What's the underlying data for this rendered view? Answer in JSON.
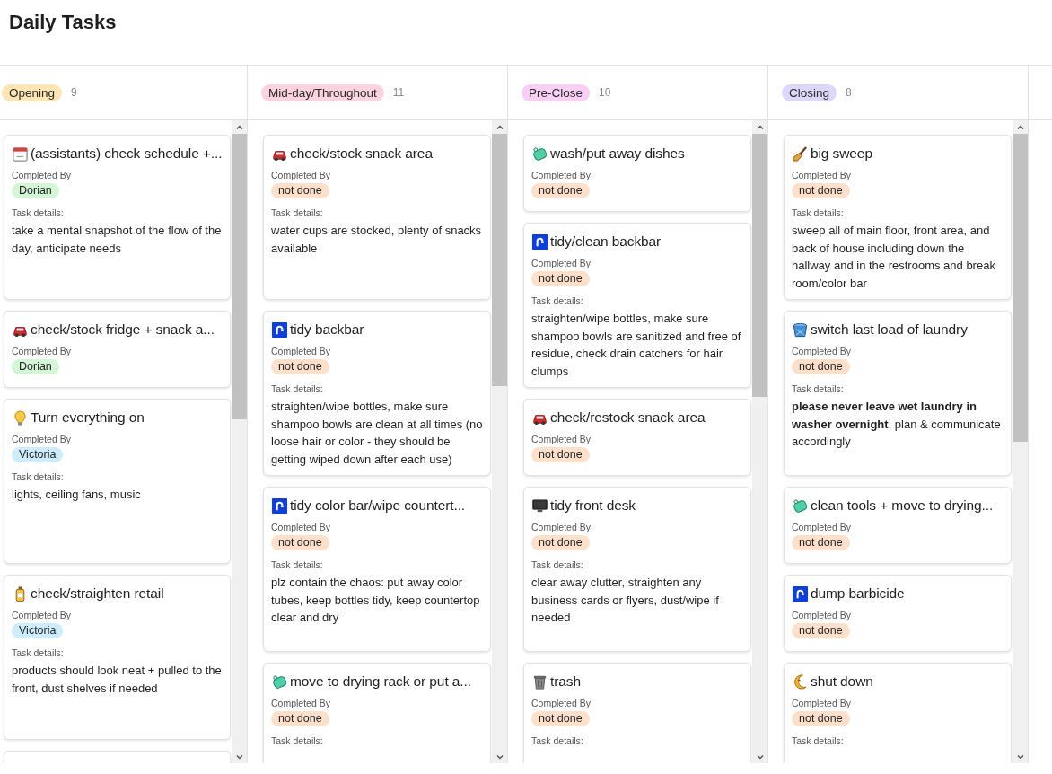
{
  "page": {
    "title": "Daily Tasks"
  },
  "columns": [
    {
      "label": "Opening",
      "color": "#fde6b4",
      "count": "9",
      "cards": [
        {
          "kind": "calendar",
          "title": "(assistants) check schedule +...",
          "completed_label": "Completed By",
          "completed_by": {
            "text": "Dorian",
            "color": "#d4f5d6"
          },
          "details_label": "Task details:",
          "details": "take a mental snapshot of the flow of the day, anticipate needs"
        },
        {
          "kind": "car",
          "title": "check/stock fridge + snack a...",
          "completed_label": "Completed By",
          "completed_by": {
            "text": "Dorian",
            "color": "#d4f5d6"
          }
        },
        {
          "kind": "bulb",
          "title": "Turn everything on",
          "completed_label": "Completed By",
          "completed_by": {
            "text": "Victoria",
            "color": "#cdecfc"
          },
          "details_label": "Task details:",
          "details": "lights, ceiling fans, music"
        },
        {
          "kind": "bottle",
          "title": "check/straighten retail",
          "completed_label": "Completed By",
          "completed_by": {
            "text": "Victoria",
            "color": "#cdecfc"
          },
          "details_label": "Task details:",
          "details": "products should look neat + pulled to the front, dust shelves if needed"
        },
        {
          "kind": "cut"
        }
      ]
    },
    {
      "label": "Mid-day/Throughout",
      "color": "#fdd3df",
      "count": "11",
      "cards": [
        {
          "kind": "car",
          "title": "check/stock snack area",
          "completed_label": "Completed By",
          "completed_by": {
            "text": "not done",
            "color": "#fde0cc"
          },
          "details_label": "Task details:",
          "details": "water cups are stocked, plenty of snacks available"
        },
        {
          "kind": "faucet",
          "title": "tidy backbar",
          "completed_label": "Completed By",
          "completed_by": {
            "text": "not done",
            "color": "#fde0cc"
          },
          "details_label": "Task details:",
          "details": "straighten/wipe bottles, make sure shampoo bowls are clean at all times (no loose hair or color - they should be getting wiped down after each use)"
        },
        {
          "kind": "faucet",
          "title": "tidy color bar/wipe countert...",
          "completed_label": "Completed By",
          "completed_by": {
            "text": "not done",
            "color": "#fde0cc"
          },
          "details_label": "Task details:",
          "details": "plz contain the chaos: put away color tubes, keep bottles tidy, keep countertop clear and dry"
        },
        {
          "kind": "soap",
          "title": "move to drying rack or put a...",
          "completed_label": "Completed By",
          "completed_by": {
            "text": "not done",
            "color": "#fde0cc"
          },
          "details_label": "Task details:"
        }
      ]
    },
    {
      "label": "Pre-Close",
      "color": "#f9cff6",
      "count": "10",
      "cards": [
        {
          "kind": "soap",
          "title": "wash/put away dishes",
          "completed_label": "Completed By",
          "completed_by": {
            "text": "not done",
            "color": "#fde0cc"
          }
        },
        {
          "kind": "faucet",
          "title": "tidy/clean backbar",
          "completed_label": "Completed By",
          "completed_by": {
            "text": "not done",
            "color": "#fde0cc"
          },
          "details_label": "Task details:",
          "details": "straighten/wipe bottles, make sure shampoo bowls are sanitized and free of residue, check drain catchers for hair clumps"
        },
        {
          "kind": "car",
          "title": "check/restock snack area",
          "completed_label": "Completed By",
          "completed_by": {
            "text": "not done",
            "color": "#fde0cc"
          }
        },
        {
          "kind": "monitor",
          "title": "tidy front desk",
          "completed_label": "Completed By",
          "completed_by": {
            "text": "not done",
            "color": "#fde0cc"
          },
          "details_label": "Task details:",
          "details": "clear away clutter, straighten any business cards or flyers, dust/wipe if needed"
        },
        {
          "kind": "trash",
          "title": "trash",
          "completed_label": "Completed By",
          "completed_by": {
            "text": "not done",
            "color": "#fde0cc"
          },
          "details_label": "Task details:"
        }
      ]
    },
    {
      "label": "Closing",
      "color": "#ddd8fb",
      "count": "8",
      "cards": [
        {
          "kind": "broom",
          "title": "big sweep",
          "completed_label": "Completed By",
          "completed_by": {
            "text": "not done",
            "color": "#fde0cc"
          },
          "details_label": "Task details:",
          "details": "sweep all of main floor, front area, and back of house including down the hallway and in the restrooms and break room/color bar"
        },
        {
          "kind": "bucket",
          "title": "switch last load of laundry",
          "completed_label": "Completed By",
          "completed_by": {
            "text": "not done",
            "color": "#fde0cc"
          },
          "details_label": "Task details:",
          "details": "**please never leave wet laundry in washer overnight**, plan & communicate accordingly"
        },
        {
          "kind": "soap",
          "title": "clean tools + move to drying...",
          "completed_label": "Completed By",
          "completed_by": {
            "text": "not done",
            "color": "#fde0cc"
          }
        },
        {
          "kind": "faucet",
          "title": "dump barbicide",
          "completed_label": "Completed By",
          "completed_by": {
            "text": "not done",
            "color": "#fde0cc"
          }
        },
        {
          "kind": "moon",
          "title": "shut down",
          "completed_label": "Completed By",
          "completed_by": {
            "text": "not done",
            "color": "#fde0cc"
          },
          "details_label": "Task details:"
        }
      ]
    }
  ]
}
